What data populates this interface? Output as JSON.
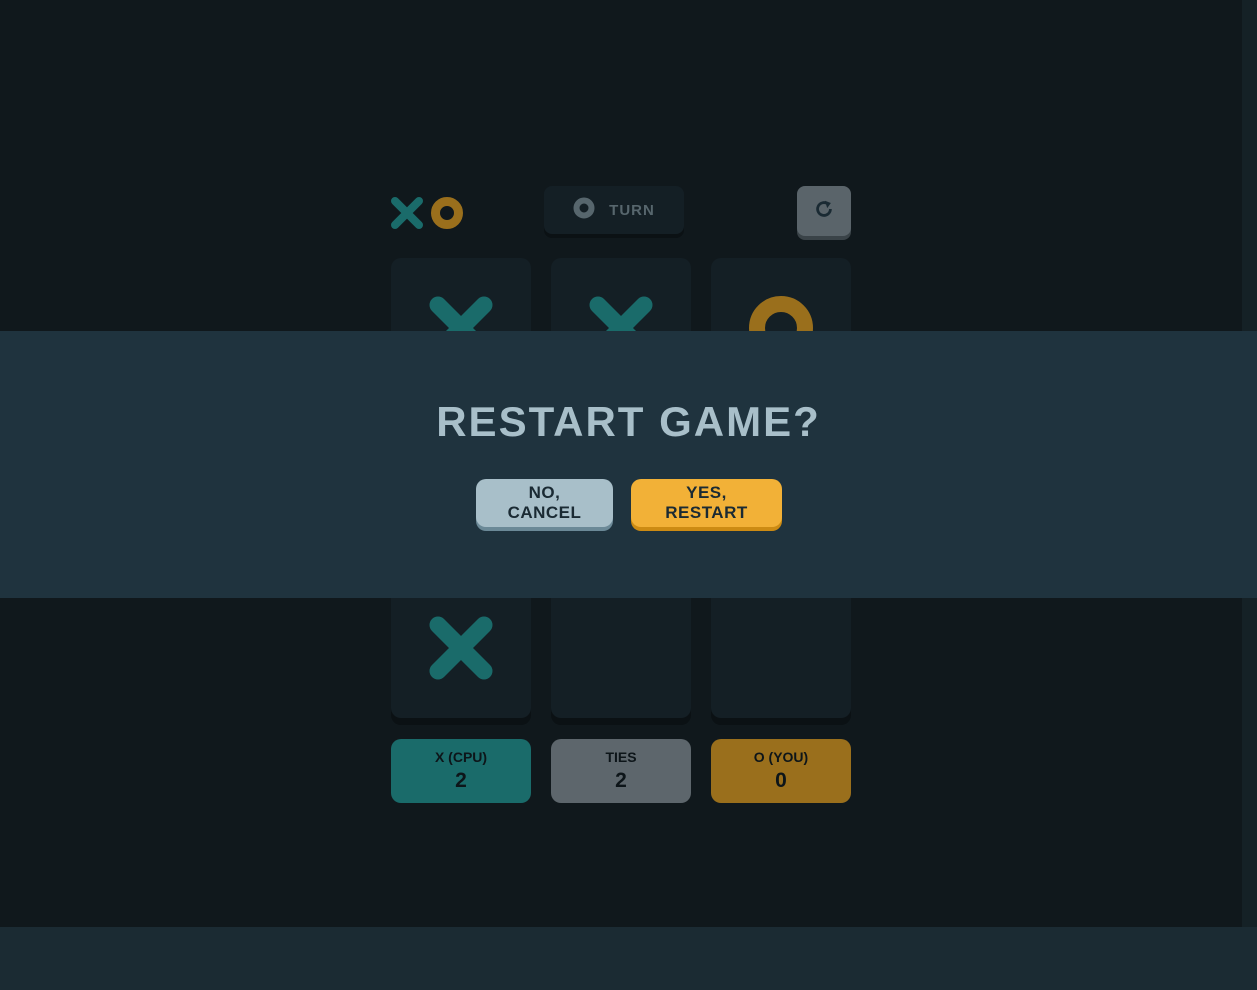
{
  "header": {
    "logo_icons": [
      "x-mark-icon",
      "o-mark-icon"
    ],
    "turn_icon": "o-mark-icon",
    "turn_label": "TURN",
    "restart_icon": "restart-icon"
  },
  "board": {
    "cells": [
      "X",
      "X",
      "O",
      "",
      "",
      "",
      "X",
      "",
      ""
    ]
  },
  "scores": {
    "x_label": "X (CPU)",
    "x_value": "2",
    "ties_label": "TIES",
    "ties_value": "2",
    "o_label": "O (YOU)",
    "o_value": "0"
  },
  "modal": {
    "title": "RESTART GAME?",
    "cancel_label": "NO, CANCEL",
    "confirm_label": "YES, RESTART"
  },
  "colors": {
    "background": "#10181c",
    "modal_background": "#1f333e",
    "x_color": "#1a6b6a",
    "o_color": "#9a6f1c",
    "cancel_button": "#a8bfc9",
    "restart_button": "#f2b137"
  }
}
